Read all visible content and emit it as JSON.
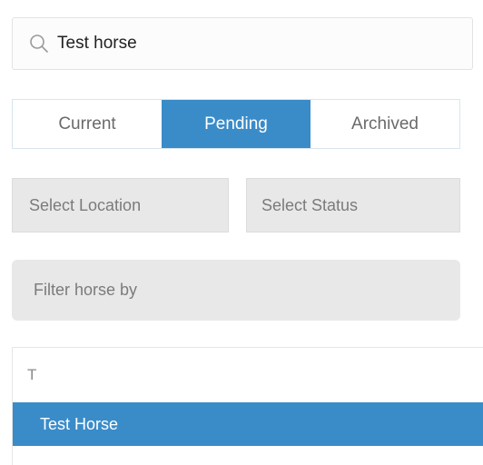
{
  "search": {
    "value": "Test horse",
    "icon": "search-icon"
  },
  "tabs": [
    {
      "label": "Current",
      "active": false
    },
    {
      "label": "Pending",
      "active": true
    },
    {
      "label": "Archived",
      "active": false
    }
  ],
  "filters": {
    "location_placeholder": "Select Location",
    "status_placeholder": "Select Status",
    "filter_placeholder": "Filter horse by"
  },
  "results": {
    "group_letter": "T",
    "items": [
      {
        "label": "Test Horse",
        "selected": true
      }
    ]
  },
  "colors": {
    "accent": "#3a8cc9",
    "field_bg": "#e8e8e8"
  }
}
